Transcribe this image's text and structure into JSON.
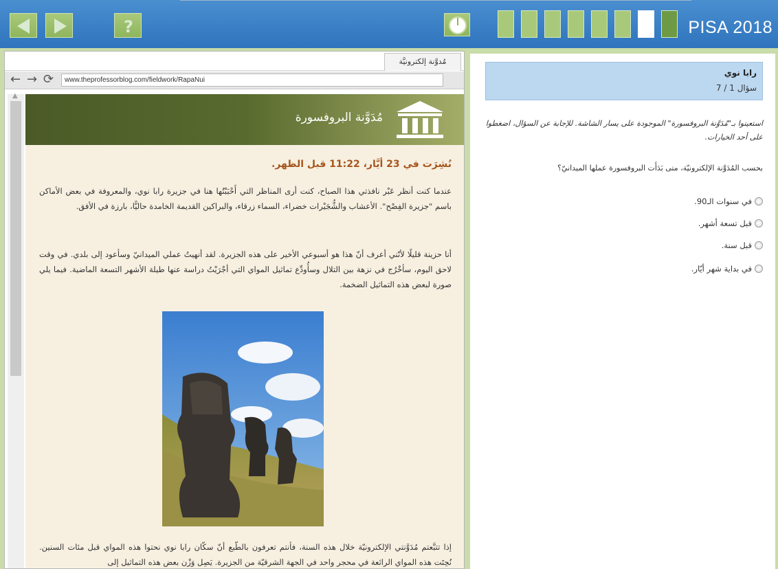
{
  "header": {
    "brand": "PISA 2018",
    "nav": [
      "back-arrow",
      "forward-arrow",
      "help"
    ],
    "help_label": "?",
    "progress_total": 8,
    "progress_current_index": 6,
    "colors": {
      "bar": "#3b82c4",
      "button": "#9dc06b",
      "active": "#ffffff",
      "dark": "#6e9a45"
    }
  },
  "browser": {
    "tab_label": "مُدوَّنة إلكترونيَّة",
    "url": "www.theprofessorblog.com/fieldwork/RapaNui"
  },
  "blog": {
    "title": "مُدَوَّنة البروفسورة",
    "post_date": "نُشِرَت في 23 أيَّار، 11:22 قبل الظهر.",
    "paragraph1": "عندما كنت أنظر عَبْر نافذتي هذا الصباح، كنت أرى المناظر التي أَحْبَبْتُها هنا في جزيرة رابا نوي، والمعروفة في بعض الأماكن باسم \"جزيرة الفِصْح\". الأعشاب والشُّجَيْرات خضراء، السماء زرقاء، والبراكين القديمة الخامدة حاليًّا، بارزة في الأفق.",
    "paragraph2": "أنا حزينة قليلًا لأنّني أعرف أنّ هذا هو أسبوعي الأخير على هذه الجزيرة. لقد أنهيتُ عملي الميدانيّ وسأعود إلى بلدي. في وقت لاحق اليوم، سأخْرُج في نزهة بين التلال وسأُودِّع تماثيل المواي التي أجْرَيْتُ دراسة عنها طيلة الأشهر التسعة الماضية. فيما يلي صورة لبعض هذه التماثيل الضخمة.",
    "paragraph3": "إذا تتبَّعتم مُدَوَّنتي الإلكترونيّة خلال هذه السنة، فأنتم تعرفون بالطّبع أنّ سكّان رابا نوي نحتوا هذه المواي قبل مئات السنين. نُحِتَت هذه المواي الرائعة في محجر واحد في الجهة الشرقيّة من الجزيرة. يَصِل وَزْن بعض هذه التماثيل إلى"
  },
  "question": {
    "unit_title": "رابا نوي",
    "counter": "سؤال 1 / 7",
    "instructions": "استعينوا بـ\"مُدَوَّنة البروفسورة\" الموجودة على يسار الشاشة. للإجابة عن السؤال، اضغطوا على أحد الخيارات.",
    "prompt": "بحسب المُدَوَّنة الإلكترونيّة، متى بَدَأَت البروفسورة عملها الميدانيّ؟",
    "options": [
      "في سنوات الـ90.",
      "قبل تسعة أشهر.",
      "قبل سنة.",
      "في بداية شهر أيّار."
    ]
  }
}
